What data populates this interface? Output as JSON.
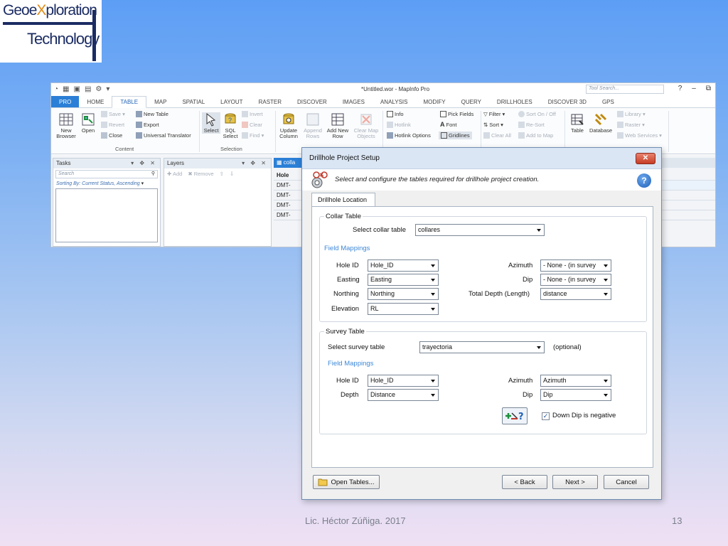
{
  "logo": {
    "line1_a": "Geoe",
    "line1_x": "X",
    "line1_b": "ploration",
    "line2": "Technology"
  },
  "app": {
    "title": "*Untitled.wor - MapInfo Pro",
    "search_placeholder": "Tool Search...",
    "window_controls": [
      "?",
      "–",
      "⧉"
    ]
  },
  "ribbon": {
    "tabs": [
      "PRO",
      "HOME",
      "TABLE",
      "MAP",
      "SPATIAL",
      "LAYOUT",
      "RASTER",
      "DISCOVER",
      "IMAGES",
      "ANALYSIS",
      "MODIFY",
      "QUERY",
      "DRILLHOLES",
      "DISCOVER 3D",
      "GPS"
    ],
    "active_tab": "TABLE",
    "content": {
      "new_browser": "New Browser",
      "open": "Open",
      "save": "Save",
      "revert": "Revert",
      "close": "Close",
      "new_table": "New Table",
      "export": "Export",
      "universal_translator": "Universal Translator",
      "group": "Content"
    },
    "selection": {
      "select": "Select",
      "sql_select": "SQL Select",
      "invert": "Invert",
      "clear": "Clear",
      "find": "Find",
      "group": "Selection"
    },
    "maintenance": {
      "update_column": "Update Column",
      "append_rows": "Append Rows",
      "add_new_row": "Add New Row",
      "clear_map_objects": "Clear Map Objects"
    },
    "info": {
      "info": "Info",
      "hotlink": "Hotlink",
      "hotlink_options": "Hotlink Options",
      "pick_fields": "Pick Fields",
      "font": "Font",
      "gridlines": "Gridlines"
    },
    "filter": {
      "filter": "Filter",
      "sort": "Sort",
      "clear_all": "Clear All",
      "sort_on_off": "Sort On / Off",
      "re_sort": "Re-Sort",
      "add_to_map": "Add to Map"
    },
    "data": {
      "table": "Table",
      "database": "Database",
      "library": "Library",
      "raster": "Raster",
      "web_services": "Web Services"
    }
  },
  "panes": {
    "tasks": {
      "title": "Tasks",
      "search": "Search",
      "sort": "Sorting By: Current Status, Ascending"
    },
    "layers": {
      "title": "Layers",
      "add": "Add",
      "remove": "Remove"
    },
    "browser": {
      "tab": "colla",
      "col_header": "Hole",
      "rows": [
        "DMT-",
        "DMT-",
        "DMT-",
        "DMT-"
      ]
    }
  },
  "dialog": {
    "title": "Drillhole Project Setup",
    "close": "✕",
    "banner": "Select and configure the tables required for drillhole project creation.",
    "tab": "Drillhole Location",
    "collar": {
      "legend": "Collar Table",
      "select_label": "Select collar table",
      "select_value": "collares",
      "field_mappings": "Field Mappings",
      "hole_id_label": "Hole ID",
      "hole_id_value": "Hole_ID",
      "easting_label": "Easting",
      "easting_value": "Easting",
      "northing_label": "Northing",
      "northing_value": "Northing",
      "elevation_label": "Elevation",
      "elevation_value": "RL",
      "azimuth_label": "Azimuth",
      "azimuth_value": "- None - (in survey",
      "dip_label": "Dip",
      "dip_value": "- None - (in survey",
      "total_depth_label": "Total Depth (Length)",
      "total_depth_value": "distance"
    },
    "survey": {
      "legend": "Survey Table",
      "select_label": "Select survey table",
      "select_value": "trayectoria",
      "optional": "(optional)",
      "field_mappings": "Field Mappings",
      "hole_id_label": "Hole ID",
      "hole_id_value": "Hole_ID",
      "depth_label": "Depth",
      "depth_value": "Distance",
      "azimuth_label": "Azimuth",
      "azimuth_value": "Azimuth",
      "dip_label": "Dip",
      "dip_value": "Dip",
      "down_dip_negative": "Down Dip is negative",
      "down_dip_checked": true
    },
    "buttons": {
      "open_tables": "Open Tables...",
      "back": "< Back",
      "next": "Next >",
      "cancel": "Cancel"
    }
  },
  "footer": {
    "author": "Lic. Héctor Zúñiga. 2017",
    "page": "13"
  }
}
